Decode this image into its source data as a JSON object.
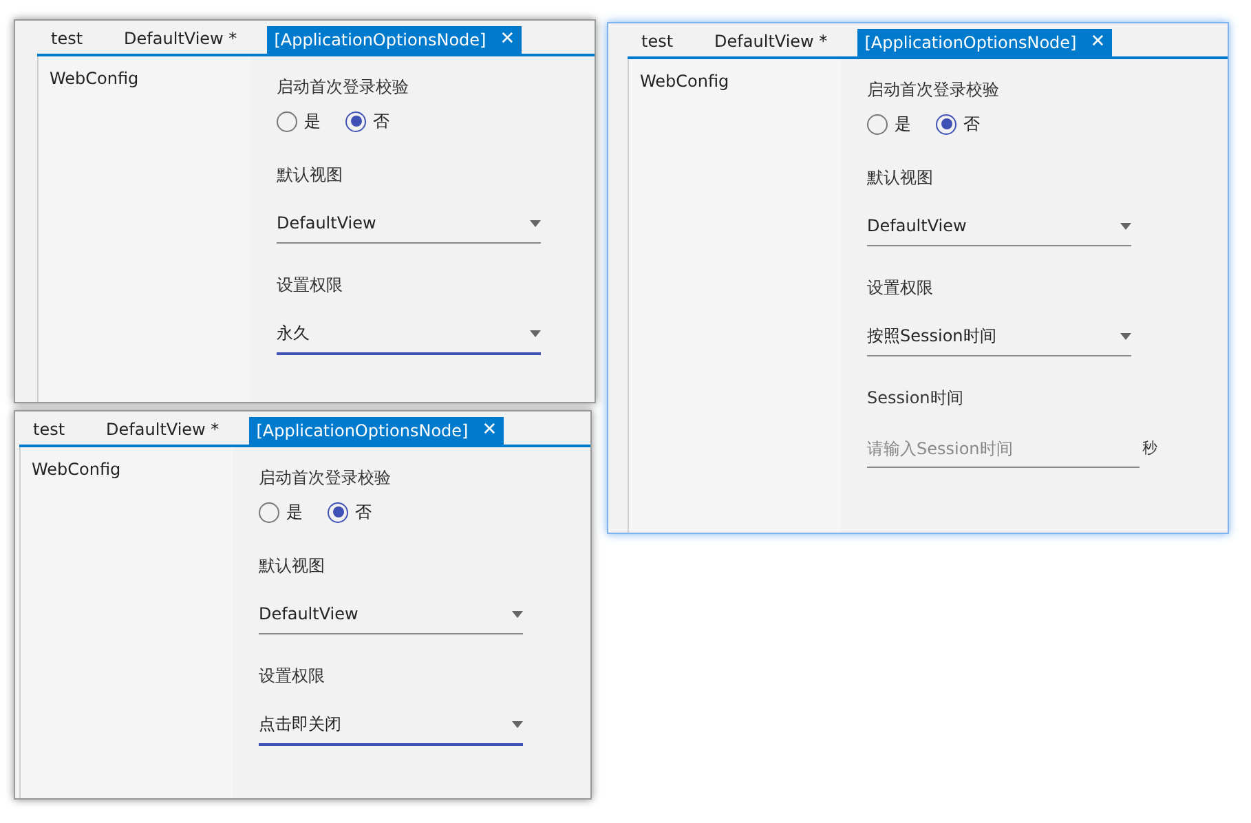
{
  "windows": [
    {
      "active": false,
      "tabs": [
        {
          "label": "test",
          "selected": false
        },
        {
          "label": "DefaultView *",
          "selected": false
        },
        {
          "label": "[ApplicationOptionsNode]",
          "selected": true,
          "close": "✕"
        }
      ],
      "tree": [
        "WebConfig"
      ],
      "fields": [
        {
          "kind": "radio",
          "label": "启动首次登录校验",
          "options": [
            {
              "label": "是",
              "selected": false
            },
            {
              "label": "否",
              "selected": true
            }
          ]
        },
        {
          "kind": "select",
          "label": "默认视图",
          "value": "DefaultView",
          "focused": false
        },
        {
          "kind": "select",
          "label": "设置权限",
          "value": "永久",
          "focused": true
        }
      ]
    },
    {
      "active": true,
      "tabs": [
        {
          "label": "test",
          "selected": false
        },
        {
          "label": "DefaultView *",
          "selected": false
        },
        {
          "label": "[ApplicationOptionsNode]",
          "selected": true,
          "close": "✕"
        }
      ],
      "tree": [
        "WebConfig"
      ],
      "fields": [
        {
          "kind": "radio",
          "label": "启动首次登录校验",
          "options": [
            {
              "label": "是",
              "selected": false
            },
            {
              "label": "否",
              "selected": true
            }
          ]
        },
        {
          "kind": "select",
          "label": "默认视图",
          "value": "DefaultView",
          "focused": false
        },
        {
          "kind": "select",
          "label": "设置权限",
          "value": "按照Session时间",
          "focused": false
        },
        {
          "kind": "input",
          "label": "Session时间",
          "placeholder": "请输入Session时间",
          "unit": "秒"
        }
      ]
    },
    {
      "active": false,
      "tabs": [
        {
          "label": "test",
          "selected": false
        },
        {
          "label": "DefaultView *",
          "selected": false
        },
        {
          "label": "[ApplicationOptionsNode]",
          "selected": true,
          "close": "✕"
        }
      ],
      "tree": [
        "WebConfig"
      ],
      "fields": [
        {
          "kind": "radio",
          "label": "启动首次登录校验",
          "options": [
            {
              "label": "是",
              "selected": false
            },
            {
              "label": "否",
              "selected": true
            }
          ]
        },
        {
          "kind": "select",
          "label": "默认视图",
          "value": "DefaultView",
          "focused": false
        },
        {
          "kind": "select",
          "label": "设置权限",
          "value": "点击即关闭",
          "focused": true
        }
      ]
    }
  ]
}
